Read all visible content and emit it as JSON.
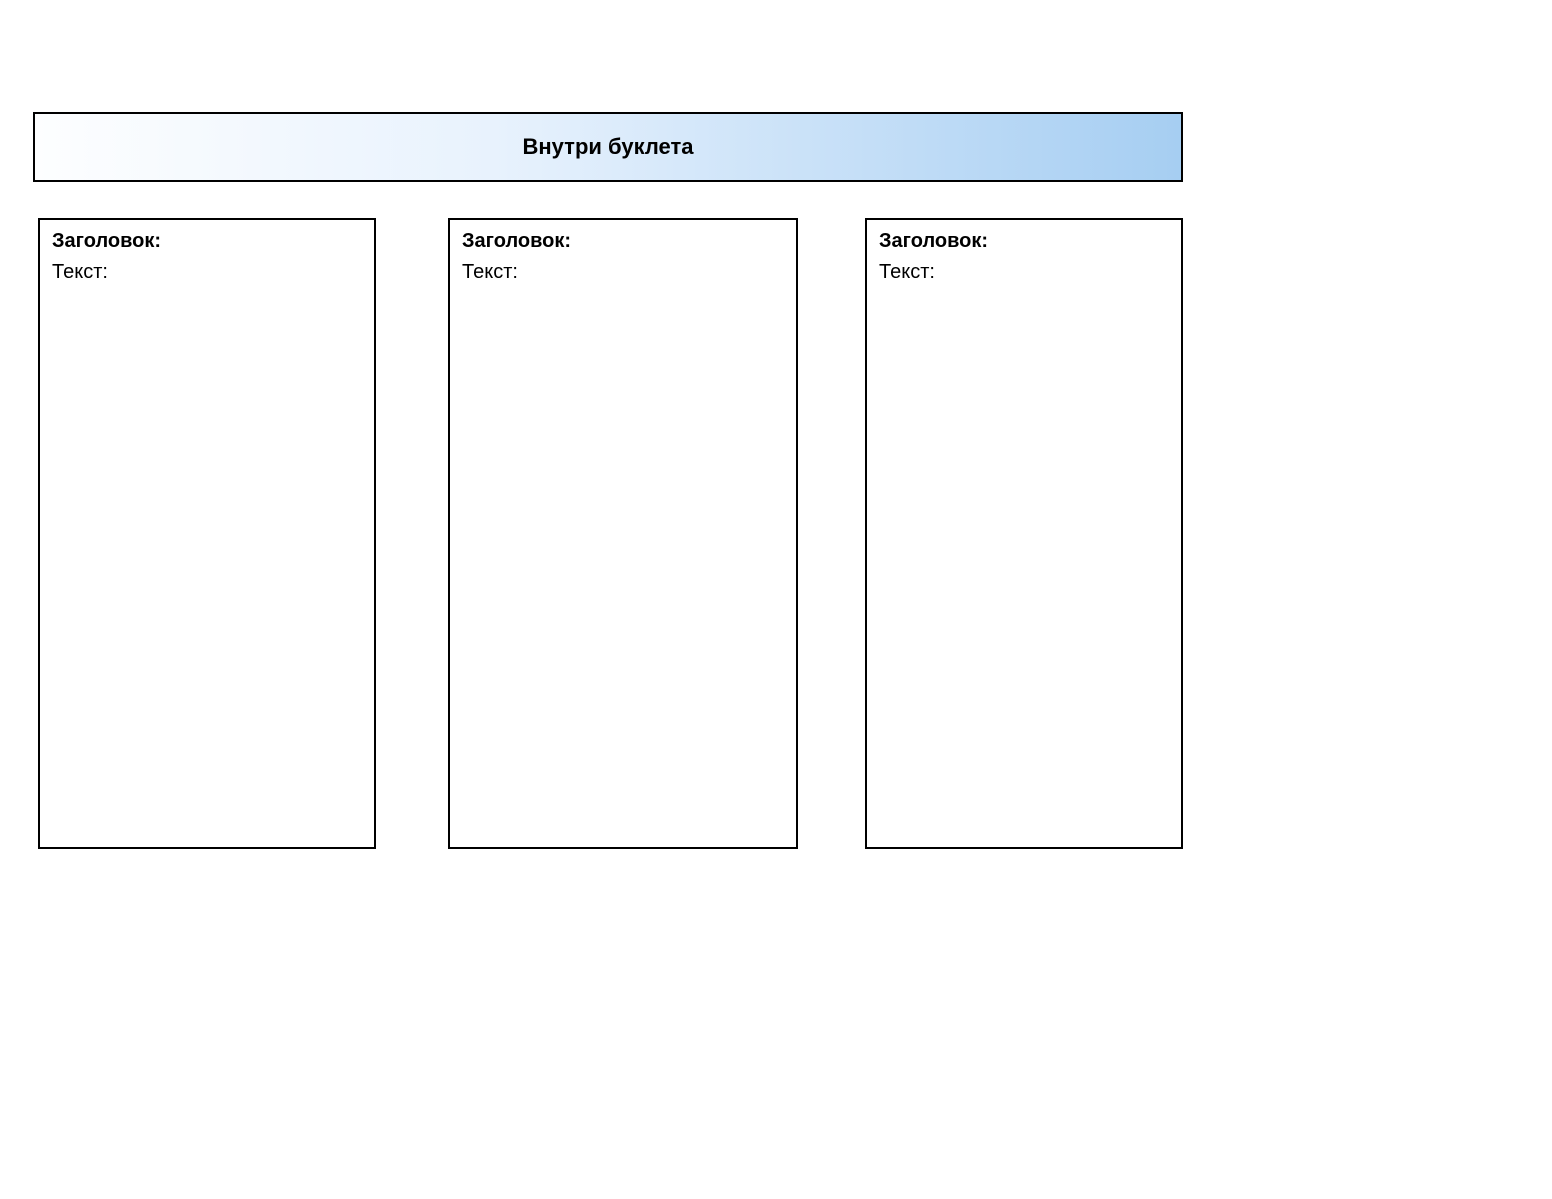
{
  "header": {
    "title": "Внутри буклета"
  },
  "panels": [
    {
      "heading": "Заголовок:",
      "text": "Текст:"
    },
    {
      "heading": "Заголовок:",
      "text": "Текст:"
    },
    {
      "heading": "Заголовок:",
      "text": "Текст:"
    }
  ]
}
